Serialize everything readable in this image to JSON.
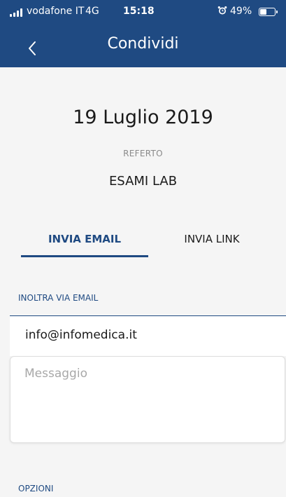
{
  "status_bar": {
    "carrier": "vodafone IT",
    "network": "4G",
    "time": "15:18",
    "battery_percent": "49%",
    "battery_level": 0.49
  },
  "nav": {
    "title": "Condividi",
    "back_icon": "chevron-left-icon"
  },
  "report": {
    "date": "19 Luglio 2019",
    "type_label": "REFERTO",
    "exam_name": "ESAMI LAB"
  },
  "tabs": [
    {
      "label": "INVIA EMAIL",
      "active": true
    },
    {
      "label": "INVIA LINK",
      "active": false
    }
  ],
  "forward": {
    "section_label": "INOLTRA VIA EMAIL",
    "email_value": "info@infomedica.it",
    "message_placeholder": "Messaggio"
  },
  "options": {
    "section_label": "OPZIONI"
  },
  "colors": {
    "brand": "#1f4a82",
    "background": "#f5f5f5"
  }
}
